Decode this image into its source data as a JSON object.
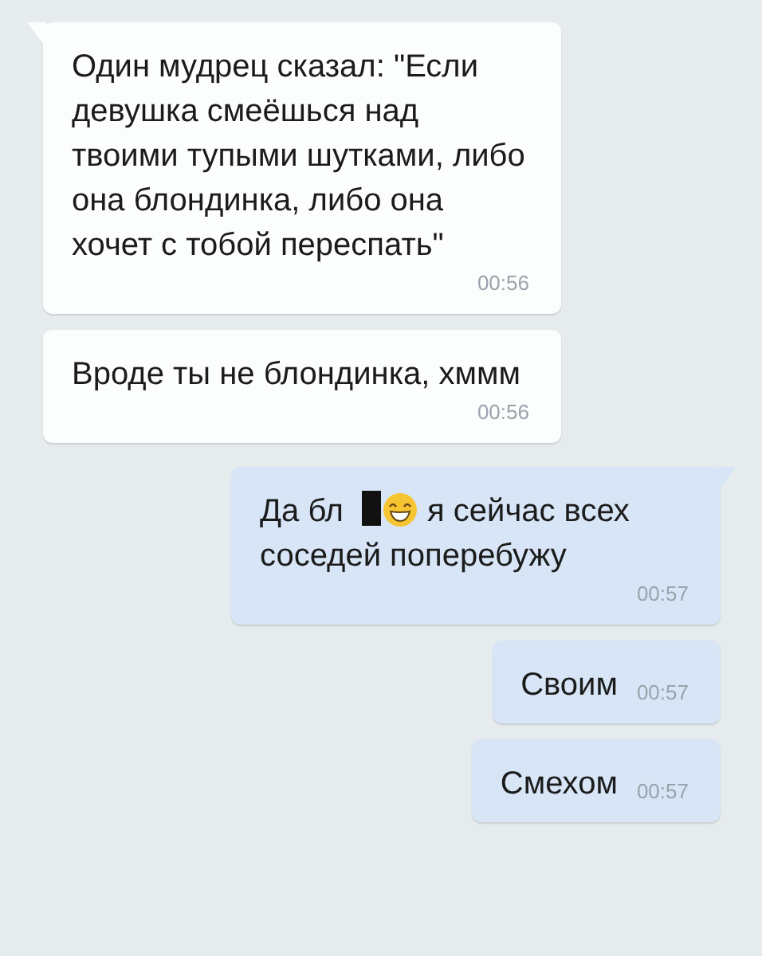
{
  "messages": [
    {
      "kind": "incoming",
      "parts": [
        {
          "kind": "text",
          "text": "Один мудрец сказал: \"Если девушка смеёшься над твоими тупыми шутками, либо она блондинка, либо она хочет с тобой переспать\""
        }
      ],
      "time": "00:56"
    },
    {
      "kind": "incoming",
      "parts": [
        {
          "kind": "text",
          "text": "Вроде ты не блондинка, хммм"
        }
      ],
      "time": "00:56"
    },
    {
      "kind": "outgoing",
      "parts": [
        {
          "kind": "word",
          "text": "Да бл"
        },
        {
          "kind": "redaction"
        },
        {
          "kind": "emoji"
        },
        {
          "kind": "word",
          "text": "я сейчас всех"
        },
        {
          "kind": "word",
          "text": "соседей поперебужу"
        }
      ],
      "time": "00:57"
    },
    {
      "kind": "outgoing",
      "parts": [
        {
          "kind": "text",
          "text": "Своим"
        }
      ],
      "time": "00:57"
    },
    {
      "kind": "outgoing",
      "parts": [
        {
          "kind": "text",
          "text": "Смехом"
        }
      ],
      "time": "00:57"
    }
  ]
}
